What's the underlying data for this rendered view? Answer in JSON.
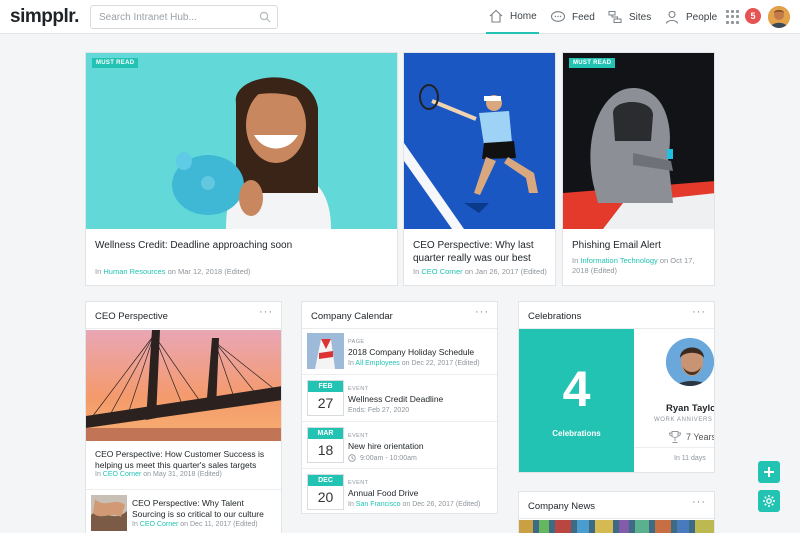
{
  "header": {
    "logo": "simpplr.",
    "search_placeholder": "Search Intranet Hub...",
    "nav": [
      {
        "label": "Home",
        "icon": "home-icon"
      },
      {
        "label": "Feed",
        "icon": "chat-icon"
      },
      {
        "label": "Sites",
        "icon": "sites-icon"
      },
      {
        "label": "People",
        "icon": "person-icon"
      }
    ],
    "notification_count": "5"
  },
  "featured": [
    {
      "badge": "MUST READ",
      "title": "Wellness Credit: Deadline approaching soon",
      "prefix": "In",
      "place": "Human Resources",
      "date": "on Mar 12, 2018 (Edited)"
    },
    {
      "badge": "",
      "title": "CEO Perspective: Why last quarter really was our best",
      "prefix": "In",
      "place": "CEO Corner",
      "date": "on Jan 26, 2017 (Edited)"
    },
    {
      "badge": "MUST READ",
      "title": "Phishing Email Alert",
      "prefix": "In",
      "place": "Information Technology",
      "date": "on Oct 17, 2018 (Edited)"
    }
  ],
  "ceo": {
    "title": "CEO Perspective",
    "items": [
      {
        "title": "CEO Perspective: How Customer Success is helping us meet this quarter's sales targets",
        "prefix": "In",
        "place": "CEO Corner",
        "date": "on May 31, 2018 (Edited)"
      },
      {
        "title": "CEO Perspective: Why Talent Sourcing is so critical to our culture",
        "prefix": "In",
        "place": "CEO Corner",
        "date": "on Dec 11, 2017 (Edited)"
      }
    ]
  },
  "calendar": {
    "title": "Company Calendar",
    "items": [
      {
        "type": "PAGE",
        "name": "2018 Company Holiday Schedule",
        "prefix": "In",
        "place": "All Employees",
        "date": "on Dec 22, 2017 (Edited)"
      },
      {
        "month": "FEB",
        "day": "27",
        "type": "EVENT",
        "name": "Wellness Credit Deadline",
        "sub": "Ends: Feb 27, 2020"
      },
      {
        "month": "MAR",
        "day": "18",
        "type": "EVENT",
        "name": "New hire orientation",
        "sub": "9:00am - 10:00am"
      },
      {
        "month": "DEC",
        "day": "20",
        "type": "EVENT",
        "name": "Annual Food Drive",
        "prefix": "In",
        "place": "San Francisco",
        "date": "on Dec 26, 2017 (Edited)"
      }
    ]
  },
  "celebrations": {
    "title": "Celebrations",
    "count": "4",
    "label": "Celebrations",
    "person": {
      "name": "Ryan Taylor",
      "tag": "WORK ANNIVERS",
      "years": "7 Years",
      "when": "In 11 days"
    }
  },
  "news": {
    "title": "Company News"
  },
  "more": "···",
  "colors": {
    "accent": "#23c3b3",
    "badge": "#e55353"
  }
}
